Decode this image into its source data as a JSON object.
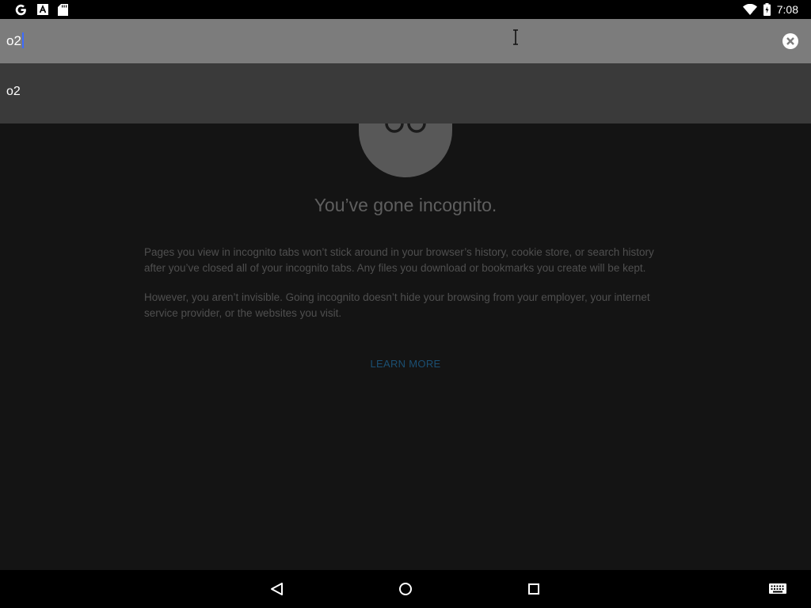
{
  "status_bar": {
    "time": "7:08",
    "left_icons": [
      "google-g-icon",
      "font-a-icon",
      "sd-card-icon"
    ],
    "right_icons": [
      "wifi-icon",
      "battery-charging-icon"
    ]
  },
  "omnibox": {
    "input_value": "o2",
    "clear_icon": "clear-icon"
  },
  "suggestions": [
    {
      "text": "o2"
    }
  ],
  "incognito_page": {
    "title": "You’ve gone incognito.",
    "paragraph_1": "Pages you view in incognito tabs won’t stick around in your browser’s history, cookie store, or search history after you’ve closed all of your incognito tabs. Any files you download or bookmarks you create will be kept.",
    "paragraph_2": "However, you aren’t invisible. Going incognito doesn’t hide your browsing from your employer, your internet service provider, or the websites you visit.",
    "learn_more": "LEARN MORE"
  },
  "nav_bar": {
    "icons": [
      "back-icon",
      "home-icon",
      "recents-icon",
      "keyboard-icon"
    ]
  },
  "colors": {
    "omnibox_bg": "#7c7c7c",
    "suggestion_bg": "#3a3a3a",
    "page_bg": "#141414",
    "caret": "#3d6cff",
    "link": "#1b4f72"
  }
}
